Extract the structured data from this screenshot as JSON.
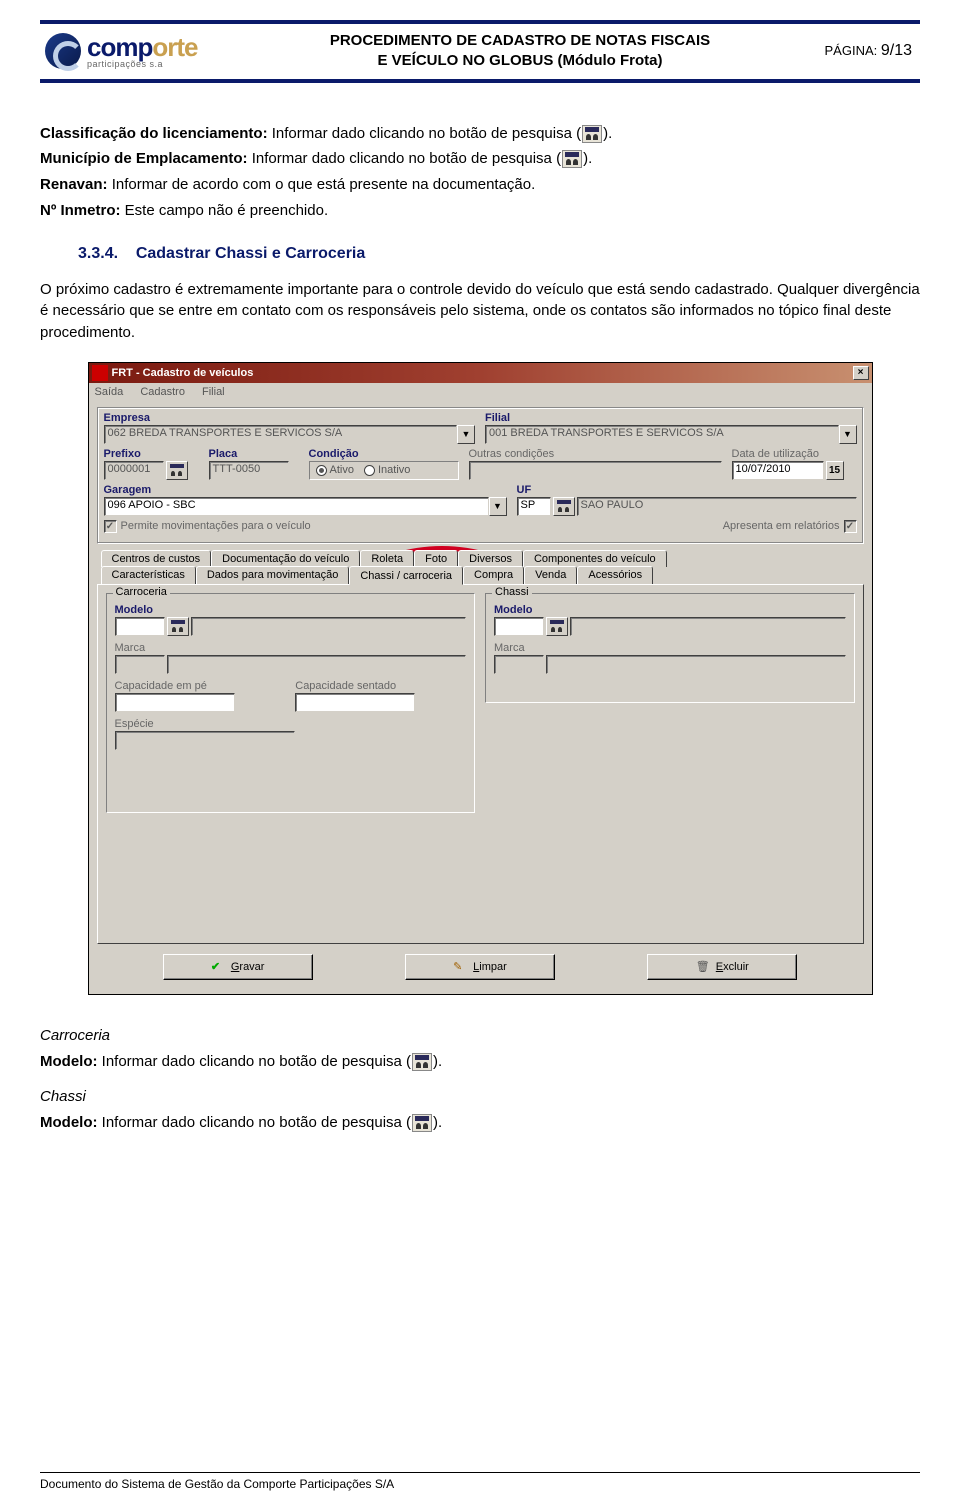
{
  "header": {
    "brand1": "comp",
    "brand2": "orte",
    "brand_sub": "participações s.a",
    "title_line1": "PROCEDIMENTO DE CADASTRO DE NOTAS FISCAIS",
    "title_line2": "E VEÍCULO NO GLOBUS (Módulo Frota)",
    "page_label": "PÁGINA: ",
    "page_num": "9/13"
  },
  "body": {
    "p1_b": "Classificação do licenciamento:",
    "p1_t": " Informar dado clicando no botão de pesquisa (",
    "p1_end": ").",
    "p2_b": "Município de Emplacamento:",
    "p2_t": " Informar dado clicando no botão de pesquisa (",
    "p2_end": ").",
    "p3_b": "Renavan:",
    "p3_t": " Informar de acordo com o que está presente na documentação.",
    "p4_b": "Nº Inmetro:",
    "p4_t": " Este campo não é preenchido.",
    "section_num": "3.3.4.",
    "section_title": "Cadastrar Chassi e Carroceria",
    "para2": "O próximo cadastro é extremamente importante para o controle devido do veículo que está sendo cadastrado. Qualquer divergência é necessário que se entre em contato com os responsáveis pelo sistema, onde os contatos são informados no tópico final deste procedimento.",
    "carroceria_head": "Carroceria",
    "carroceria_b": "Modelo:",
    "carroceria_t": " Informar dado clicando no botão de pesquisa (",
    "carroceria_end": ").",
    "chassi_head": "Chassi",
    "chassi_b": "Modelo:",
    "chassi_t": " Informar dado clicando no botão de pesquisa (",
    "chassi_end": ")."
  },
  "win": {
    "title": "FRT - Cadastro de veículos",
    "menu": [
      "Saída",
      "Cadastro",
      "Filial"
    ],
    "empresa_label": "Empresa",
    "empresa_value": "062 BREDA TRANSPORTES E SERVICOS S/A",
    "filial_label": "Filial",
    "filial_value": "001 BREDA TRANSPORTES E SERVICOS S/A",
    "prefixo_label": "Prefixo",
    "prefixo_value": "0000001",
    "placa_label": "Placa",
    "placa_value": "TTT-0050",
    "condicao_label": "Condição",
    "condicao_ativo": "Ativo",
    "condicao_inativo": "Inativo",
    "outras_label": "Outras condições",
    "data_label": "Data de utilização",
    "data_value": "10/07/2010",
    "garagem_label": "Garagem",
    "garagem_value": "096 APOIO - SBC",
    "uf_label": "UF",
    "uf_value": "SP",
    "uf_name": "SAO PAULO",
    "permite": "Permite movimentações para o veículo",
    "apresenta": "Apresenta em relatórios",
    "tabs_back": [
      "Centros de custos",
      "Documentação do veículo",
      "Roleta",
      "Foto",
      "Diversos",
      "Componentes do veículo"
    ],
    "tabs_front": [
      "Características",
      "Dados para movimentação",
      "Chassi / carroceria",
      "Compra",
      "Venda",
      "Acessórios"
    ],
    "carroceria_legend": "Carroceria",
    "chassi_legend": "Chassi",
    "modelo": "Modelo",
    "marca": "Marca",
    "cap_pe": "Capacidade em pé",
    "cap_sent": "Capacidade sentado",
    "especie": "Espécie",
    "btn_gravar": "Gravar",
    "btn_limpar": "Limpar",
    "btn_excluir": "Excluir"
  },
  "footer": "Documento do Sistema de Gestão da Comporte Participações S/A"
}
